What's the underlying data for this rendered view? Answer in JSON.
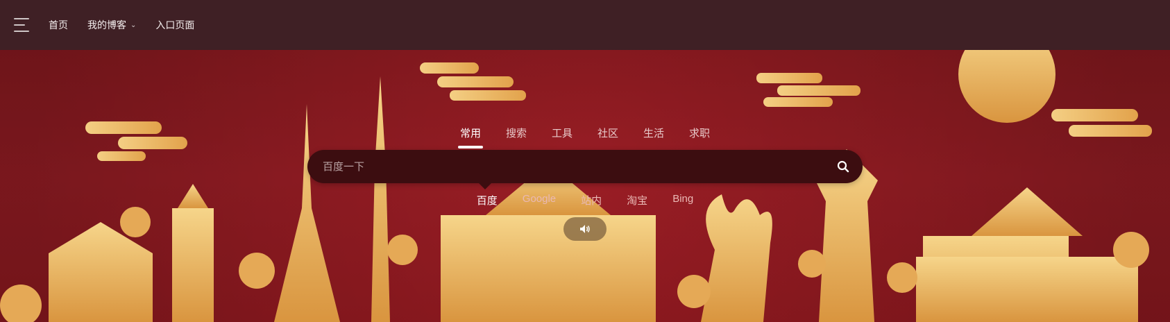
{
  "nav": {
    "items": [
      {
        "label": "首页"
      },
      {
        "label": "我的博客"
      },
      {
        "label": "入口页面"
      }
    ]
  },
  "search": {
    "tabs": [
      "常用",
      "搜索",
      "工具",
      "社区",
      "生活",
      "求职"
    ],
    "active_tab": "常用",
    "placeholder": "百度一下",
    "engines": [
      "百度",
      "Google",
      "站内",
      "淘宝",
      "Bing"
    ],
    "active_engine": "百度"
  },
  "icons": {
    "menu": "hamburger-menu-icon",
    "search": "search-icon",
    "sound": "speaker-icon",
    "caret": "chevron-down-icon"
  },
  "colors": {
    "topbar": "#3f2025",
    "background": "#9b1b22",
    "gold": "#e9b85a",
    "search_box": "#3c0d10"
  }
}
